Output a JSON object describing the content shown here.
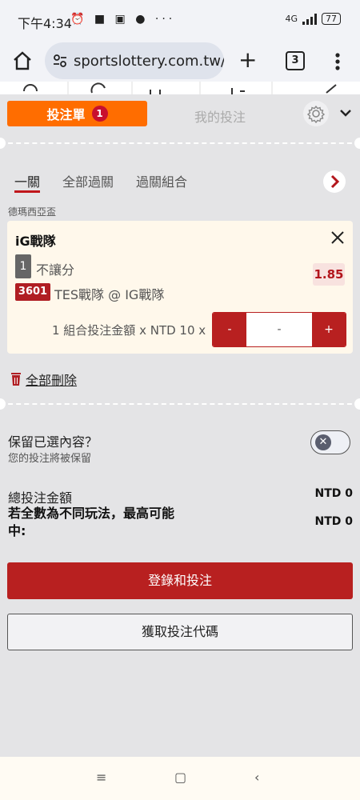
{
  "statusbar": {
    "time": "下午4:34",
    "icons": "⏰ ■ ▣ ●  ···",
    "network": "4G",
    "battery": "77"
  },
  "browser": {
    "url": "sportslottery.com.tw/s",
    "tab_count": "3"
  },
  "betslip": {
    "tab_betslip": "投注單",
    "betslip_count": "1",
    "tab_mybets": "我的投注",
    "subtabs": [
      "一關",
      "全部過關",
      "過關組合"
    ],
    "league": "德瑪西亞盃",
    "bet": {
      "team": "iG戰隊",
      "game_no": "1",
      "market": "不讓分",
      "odds": "1.85",
      "event_code": "3601",
      "match": "TES戰隊 @ IG戰隊"
    },
    "stake_label": "1 組合投注金額 x NTD 10 x",
    "stepper": {
      "minus": "-",
      "value": "-",
      "plus": "+"
    },
    "delete_all": "全部刪除",
    "keep": {
      "title": "保留已選內容？",
      "subtitle": "您的投注將被保留",
      "enabled": false
    },
    "summary": {
      "total_label": "總投注金額",
      "total_value": "NTD 0",
      "max_label": "若全數為不同玩法，最高可能中:",
      "max_value": "NTD 0"
    },
    "login_button": "登錄和投注",
    "code_button": "獲取投注代碼"
  },
  "navbar": {
    "menu": "≡",
    "home": "▢",
    "back": "‹"
  }
}
